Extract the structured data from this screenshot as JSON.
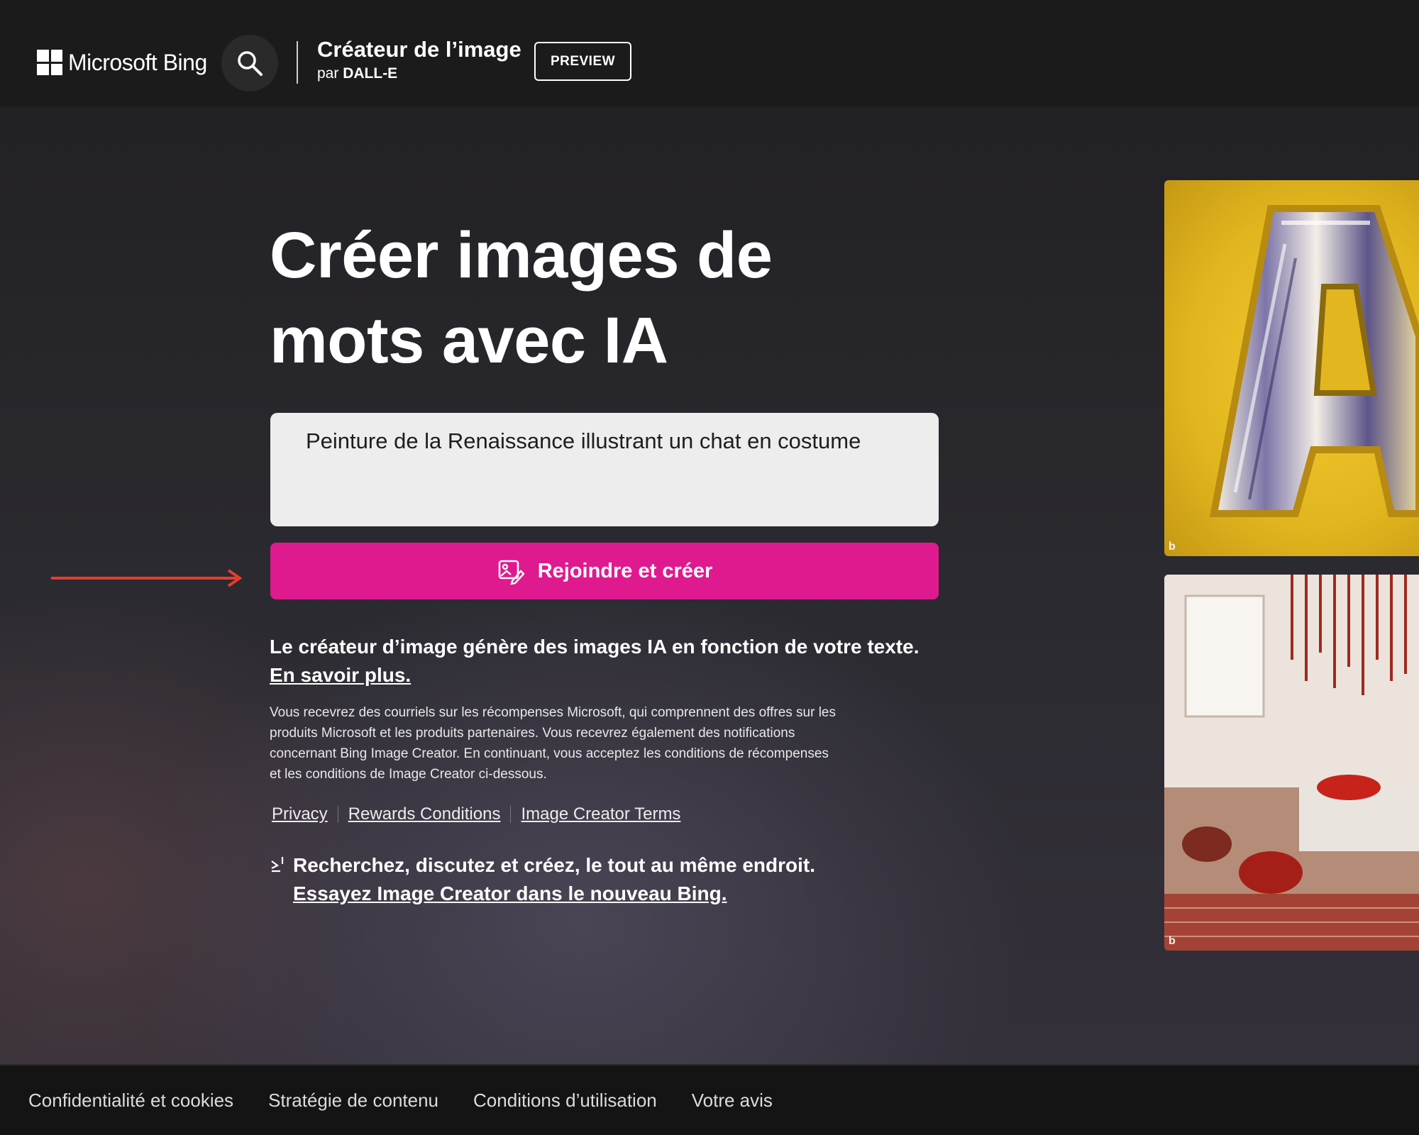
{
  "header": {
    "brand": "Microsoft Bing",
    "product_title": "Créateur de l’image",
    "product_sub_prefix": "par",
    "product_sub_name": "DALL-E",
    "badge": "PREVIEW"
  },
  "hero": {
    "title_line1": "Créer images de",
    "title_line2": "mots avec IA"
  },
  "prompt": {
    "value": "Peinture de la Renaissance illustrant un chat en costume"
  },
  "cta": {
    "label": "Rejoindre et créer"
  },
  "description": {
    "text": "Le créateur d’image génère des images IA en fonction de votre texte.",
    "link": "En savoir plus."
  },
  "fine_print": "Vous recevrez des courriels sur les récompenses Microsoft, qui comprennent des offres sur les produits Microsoft et les produits partenaires. Vous recevrez également des notifications concernant Bing Image Creator. En continuant, vous acceptez les conditions de récompenses et les conditions de Image Creator ci-dessous.",
  "legal_links": [
    "Privacy",
    "Rewards Conditions",
    "Image Creator Terms"
  ],
  "promo": {
    "text": "Recherchez, discutez et créez, le tout au même endroit.",
    "link": "Essayez Image Creator dans le nouveau Bing."
  },
  "footer": {
    "links": [
      "Confidentialité et cookies",
      "Stratégie de contenu",
      "Conditions d’utilisation",
      "Votre avis"
    ]
  },
  "colors": {
    "accent": "#df1a8f",
    "arrow": "#e63c2e",
    "header_bg": "#1b1b1b"
  },
  "icons": {
    "search": "search-icon",
    "create": "image-create-icon",
    "promo": "bing-chat-icon"
  }
}
